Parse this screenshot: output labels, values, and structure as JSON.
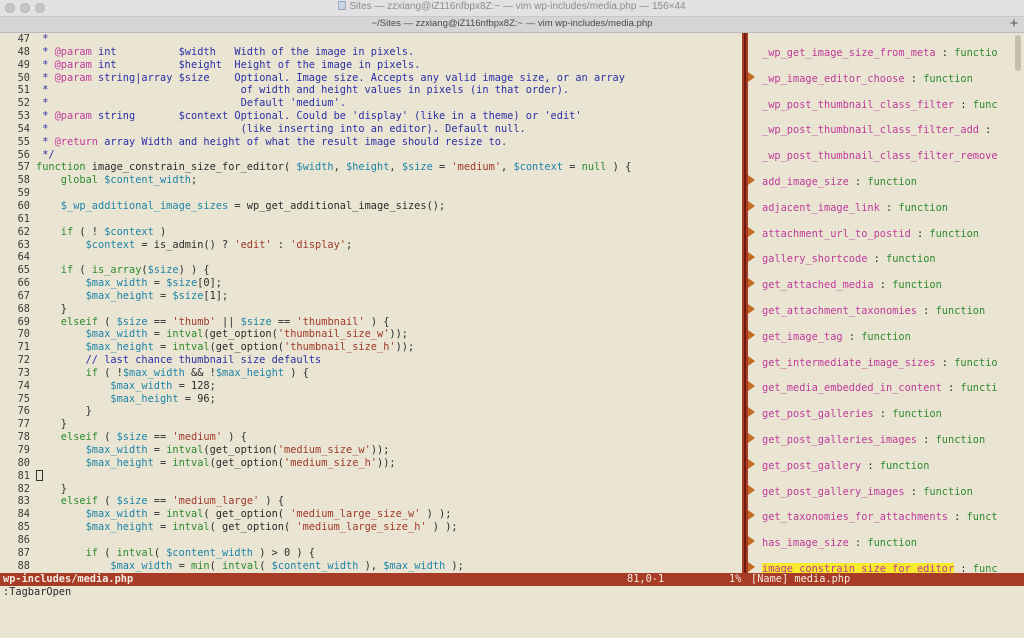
{
  "window": {
    "title": "Sites — zzxiang@iZ116nfbpx8Z:~ — vim wp-includes/media.php — 156×44",
    "tab_title": "~/Sites — zzxiang@iZ116nfbpx8Z:~ — vim wp-includes/media.php",
    "new_tab_label": "+"
  },
  "code_lines": [
    {
      "n": "47",
      "segs": [
        {
          "c": "cm",
          "t": " *"
        }
      ]
    },
    {
      "n": "48",
      "segs": [
        {
          "c": "cm",
          "t": " * "
        },
        {
          "c": "tag",
          "t": "@param"
        },
        {
          "c": "cm",
          "t": " int          $width   Width of the image in pixels."
        }
      ]
    },
    {
      "n": "49",
      "segs": [
        {
          "c": "cm",
          "t": " * "
        },
        {
          "c": "tag",
          "t": "@param"
        },
        {
          "c": "cm",
          "t": " int          $height  Height of the image in pixels."
        }
      ]
    },
    {
      "n": "50",
      "segs": [
        {
          "c": "cm",
          "t": " * "
        },
        {
          "c": "tag",
          "t": "@param"
        },
        {
          "c": "cm",
          "t": " string|array $size    Optional. Image size. Accepts any valid image size, or an array"
        }
      ]
    },
    {
      "n": "51",
      "segs": [
        {
          "c": "cm",
          "t": " *                               of width and height values in pixels (in that order)."
        }
      ]
    },
    {
      "n": "52",
      "segs": [
        {
          "c": "cm",
          "t": " *                               Default 'medium'."
        }
      ]
    },
    {
      "n": "53",
      "segs": [
        {
          "c": "cm",
          "t": " * "
        },
        {
          "c": "tag",
          "t": "@param"
        },
        {
          "c": "cm",
          "t": " string       $context Optional. Could be 'display' (like in a theme) or 'edit'"
        }
      ]
    },
    {
      "n": "54",
      "segs": [
        {
          "c": "cm",
          "t": " *                               (like inserting into an editor). Default null."
        }
      ]
    },
    {
      "n": "55",
      "segs": [
        {
          "c": "cm",
          "t": " * "
        },
        {
          "c": "tag",
          "t": "@return"
        },
        {
          "c": "cm",
          "t": " array Width and height of what the result image should resize to."
        }
      ]
    },
    {
      "n": "56",
      "segs": [
        {
          "c": "cm",
          "t": " */"
        }
      ]
    },
    {
      "n": "57",
      "segs": [
        {
          "c": "kw",
          "t": "function"
        },
        {
          "c": "plain",
          "t": " image_constrain_size_for_editor( "
        },
        {
          "c": "var",
          "t": "$width"
        },
        {
          "c": "plain",
          "t": ", "
        },
        {
          "c": "var",
          "t": "$height"
        },
        {
          "c": "plain",
          "t": ", "
        },
        {
          "c": "var",
          "t": "$size"
        },
        {
          "c": "plain",
          "t": " = "
        },
        {
          "c": "str",
          "t": "'medium'"
        },
        {
          "c": "plain",
          "t": ", "
        },
        {
          "c": "var",
          "t": "$context"
        },
        {
          "c": "plain",
          "t": " = "
        },
        {
          "c": "kw",
          "t": "null"
        },
        {
          "c": "plain",
          "t": " ) {"
        }
      ]
    },
    {
      "n": "58",
      "segs": [
        {
          "c": "kw",
          "t": "    global"
        },
        {
          "c": "plain",
          "t": " "
        },
        {
          "c": "var",
          "t": "$content_width"
        },
        {
          "c": "plain",
          "t": ";"
        }
      ]
    },
    {
      "n": "59",
      "segs": []
    },
    {
      "n": "60",
      "segs": [
        {
          "c": "var",
          "t": "    $_wp_additional_image_sizes"
        },
        {
          "c": "plain",
          "t": " = wp_get_additional_image_sizes();"
        }
      ]
    },
    {
      "n": "61",
      "segs": []
    },
    {
      "n": "62",
      "segs": [
        {
          "c": "kw",
          "t": "    if"
        },
        {
          "c": "plain",
          "t": " ( ! "
        },
        {
          "c": "var",
          "t": "$context"
        },
        {
          "c": "plain",
          "t": " )"
        }
      ]
    },
    {
      "n": "63",
      "segs": [
        {
          "c": "var",
          "t": "        $context"
        },
        {
          "c": "plain",
          "t": " = is_admin() ? "
        },
        {
          "c": "str",
          "t": "'edit'"
        },
        {
          "c": "plain",
          "t": " : "
        },
        {
          "c": "str",
          "t": "'display'"
        },
        {
          "c": "plain",
          "t": ";"
        }
      ]
    },
    {
      "n": "64",
      "segs": []
    },
    {
      "n": "65",
      "segs": [
        {
          "c": "kw",
          "t": "    if"
        },
        {
          "c": "plain",
          "t": " ( "
        },
        {
          "c": "fn",
          "t": "is_array"
        },
        {
          "c": "plain",
          "t": "("
        },
        {
          "c": "var",
          "t": "$size"
        },
        {
          "c": "plain",
          "t": ") ) {"
        }
      ]
    },
    {
      "n": "66",
      "segs": [
        {
          "c": "var",
          "t": "        $max_width"
        },
        {
          "c": "plain",
          "t": " = "
        },
        {
          "c": "var",
          "t": "$size"
        },
        {
          "c": "plain",
          "t": "[0];"
        }
      ]
    },
    {
      "n": "67",
      "segs": [
        {
          "c": "var",
          "t": "        $max_height"
        },
        {
          "c": "plain",
          "t": " = "
        },
        {
          "c": "var",
          "t": "$size"
        },
        {
          "c": "plain",
          "t": "[1];"
        }
      ]
    },
    {
      "n": "68",
      "segs": [
        {
          "c": "plain",
          "t": "    }"
        }
      ]
    },
    {
      "n": "69",
      "segs": [
        {
          "c": "kw",
          "t": "    elseif"
        },
        {
          "c": "plain",
          "t": " ( "
        },
        {
          "c": "var",
          "t": "$size"
        },
        {
          "c": "plain",
          "t": " == "
        },
        {
          "c": "str",
          "t": "'thumb'"
        },
        {
          "c": "plain",
          "t": " || "
        },
        {
          "c": "var",
          "t": "$size"
        },
        {
          "c": "plain",
          "t": " == "
        },
        {
          "c": "str",
          "t": "'thumbnail'"
        },
        {
          "c": "plain",
          "t": " ) {"
        }
      ]
    },
    {
      "n": "70",
      "segs": [
        {
          "c": "var",
          "t": "        $max_width"
        },
        {
          "c": "plain",
          "t": " = "
        },
        {
          "c": "fn",
          "t": "intval"
        },
        {
          "c": "plain",
          "t": "(get_option("
        },
        {
          "c": "str",
          "t": "'thumbnail_size_w'"
        },
        {
          "c": "plain",
          "t": "));"
        }
      ]
    },
    {
      "n": "71",
      "segs": [
        {
          "c": "var",
          "t": "        $max_height"
        },
        {
          "c": "plain",
          "t": " = "
        },
        {
          "c": "fn",
          "t": "intval"
        },
        {
          "c": "plain",
          "t": "(get_option("
        },
        {
          "c": "str",
          "t": "'thumbnail_size_h'"
        },
        {
          "c": "plain",
          "t": "));"
        }
      ]
    },
    {
      "n": "72",
      "segs": [
        {
          "c": "cm",
          "t": "        // last chance thumbnail size defaults"
        }
      ]
    },
    {
      "n": "73",
      "segs": [
        {
          "c": "kw",
          "t": "        if"
        },
        {
          "c": "plain",
          "t": " ( !"
        },
        {
          "c": "var",
          "t": "$max_width"
        },
        {
          "c": "plain",
          "t": " && !"
        },
        {
          "c": "var",
          "t": "$max_height"
        },
        {
          "c": "plain",
          "t": " ) {"
        }
      ]
    },
    {
      "n": "74",
      "segs": [
        {
          "c": "var",
          "t": "            $max_width"
        },
        {
          "c": "plain",
          "t": " = 128;"
        }
      ]
    },
    {
      "n": "75",
      "segs": [
        {
          "c": "var",
          "t": "            $max_height"
        },
        {
          "c": "plain",
          "t": " = 96;"
        }
      ]
    },
    {
      "n": "76",
      "segs": [
        {
          "c": "plain",
          "t": "        }"
        }
      ]
    },
    {
      "n": "77",
      "segs": [
        {
          "c": "plain",
          "t": "    }"
        }
      ]
    },
    {
      "n": "78",
      "segs": [
        {
          "c": "kw",
          "t": "    elseif"
        },
        {
          "c": "plain",
          "t": " ( "
        },
        {
          "c": "var",
          "t": "$size"
        },
        {
          "c": "plain",
          "t": " == "
        },
        {
          "c": "str",
          "t": "'medium'"
        },
        {
          "c": "plain",
          "t": " ) {"
        }
      ]
    },
    {
      "n": "79",
      "segs": [
        {
          "c": "var",
          "t": "        $max_width"
        },
        {
          "c": "plain",
          "t": " = "
        },
        {
          "c": "fn",
          "t": "intval"
        },
        {
          "c": "plain",
          "t": "(get_option("
        },
        {
          "c": "str",
          "t": "'medium_size_w'"
        },
        {
          "c": "plain",
          "t": "));"
        }
      ]
    },
    {
      "n": "80",
      "segs": [
        {
          "c": "var",
          "t": "        $max_height"
        },
        {
          "c": "plain",
          "t": " = "
        },
        {
          "c": "fn",
          "t": "intval"
        },
        {
          "c": "plain",
          "t": "(get_option("
        },
        {
          "c": "str",
          "t": "'medium_size_h'"
        },
        {
          "c": "plain",
          "t": "));"
        }
      ]
    },
    {
      "n": "81",
      "cursor": true,
      "segs": []
    },
    {
      "n": "82",
      "segs": [
        {
          "c": "plain",
          "t": "    }"
        }
      ]
    },
    {
      "n": "83",
      "segs": [
        {
          "c": "kw",
          "t": "    elseif"
        },
        {
          "c": "plain",
          "t": " ( "
        },
        {
          "c": "var",
          "t": "$size"
        },
        {
          "c": "plain",
          "t": " == "
        },
        {
          "c": "str",
          "t": "'medium_large'"
        },
        {
          "c": "plain",
          "t": " ) {"
        }
      ]
    },
    {
      "n": "84",
      "segs": [
        {
          "c": "var",
          "t": "        $max_width"
        },
        {
          "c": "plain",
          "t": " = "
        },
        {
          "c": "fn",
          "t": "intval"
        },
        {
          "c": "plain",
          "t": "( get_option( "
        },
        {
          "c": "str",
          "t": "'medium_large_size_w'"
        },
        {
          "c": "plain",
          "t": " ) );"
        }
      ]
    },
    {
      "n": "85",
      "segs": [
        {
          "c": "var",
          "t": "        $max_height"
        },
        {
          "c": "plain",
          "t": " = "
        },
        {
          "c": "fn",
          "t": "intval"
        },
        {
          "c": "plain",
          "t": "( get_option( "
        },
        {
          "c": "str",
          "t": "'medium_large_size_h'"
        },
        {
          "c": "plain",
          "t": " ) );"
        }
      ]
    },
    {
      "n": "86",
      "segs": []
    },
    {
      "n": "87",
      "segs": [
        {
          "c": "kw",
          "t": "        if"
        },
        {
          "c": "plain",
          "t": " ( "
        },
        {
          "c": "fn",
          "t": "intval"
        },
        {
          "c": "plain",
          "t": "( "
        },
        {
          "c": "var",
          "t": "$content_width"
        },
        {
          "c": "plain",
          "t": " ) > 0 ) {"
        }
      ]
    },
    {
      "n": "88",
      "segs": [
        {
          "c": "var",
          "t": "            $max_width"
        },
        {
          "c": "plain",
          "t": " = "
        },
        {
          "c": "fn",
          "t": "min"
        },
        {
          "c": "plain",
          "t": "( "
        },
        {
          "c": "fn",
          "t": "intval"
        },
        {
          "c": "plain",
          "t": "( "
        },
        {
          "c": "var",
          "t": "$content_width"
        },
        {
          "c": "plain",
          "t": " ), "
        },
        {
          "c": "var",
          "t": "$max_width"
        },
        {
          "c": "plain",
          "t": " );"
        }
      ]
    }
  ],
  "tagbar": {
    "items": [
      {
        "name": "_wp_get_image_size_from_meta",
        "sep": " : ",
        "kind": "functio",
        "arrow": false,
        "highlight": false
      },
      {
        "name": "_wp_image_editor_choose",
        "sep": " : ",
        "kind": "function",
        "arrow": true,
        "highlight": false
      },
      {
        "name": "_wp_post_thumbnail_class_filter",
        "sep": " : ",
        "kind": "func",
        "arrow": false,
        "highlight": false
      },
      {
        "name": "_wp_post_thumbnail_class_filter_add",
        "sep": " :",
        "kind": "",
        "arrow": false,
        "highlight": false
      },
      {
        "name": "_wp_post_thumbnail_class_filter_remove",
        "sep": "",
        "kind": "",
        "arrow": false,
        "highlight": false
      },
      {
        "name": "add_image_size",
        "sep": " : ",
        "kind": "function",
        "arrow": true,
        "highlight": false
      },
      {
        "name": "adjacent_image_link",
        "sep": " : ",
        "kind": "function",
        "arrow": true,
        "highlight": false
      },
      {
        "name": "attachment_url_to_postid",
        "sep": " : ",
        "kind": "function",
        "arrow": true,
        "highlight": false
      },
      {
        "name": "gallery_shortcode",
        "sep": " : ",
        "kind": "function",
        "arrow": true,
        "highlight": false
      },
      {
        "name": "get_attached_media",
        "sep": " : ",
        "kind": "function",
        "arrow": true,
        "highlight": false
      },
      {
        "name": "get_attachment_taxonomies",
        "sep": " : ",
        "kind": "function",
        "arrow": true,
        "highlight": false
      },
      {
        "name": "get_image_tag",
        "sep": " : ",
        "kind": "function",
        "arrow": true,
        "highlight": false
      },
      {
        "name": "get_intermediate_image_sizes",
        "sep": " : ",
        "kind": "functio",
        "arrow": true,
        "highlight": false
      },
      {
        "name": "get_media_embedded_in_content",
        "sep": " : ",
        "kind": "functi",
        "arrow": true,
        "highlight": false
      },
      {
        "name": "get_post_galleries",
        "sep": " : ",
        "kind": "function",
        "arrow": true,
        "highlight": false
      },
      {
        "name": "get_post_galleries_images",
        "sep": " : ",
        "kind": "function",
        "arrow": true,
        "highlight": false
      },
      {
        "name": "get_post_gallery",
        "sep": " : ",
        "kind": "function",
        "arrow": true,
        "highlight": false
      },
      {
        "name": "get_post_gallery_images",
        "sep": " : ",
        "kind": "function",
        "arrow": true,
        "highlight": false
      },
      {
        "name": "get_taxonomies_for_attachments",
        "sep": " : ",
        "kind": "funct",
        "arrow": true,
        "highlight": false
      },
      {
        "name": "has_image_size",
        "sep": " : ",
        "kind": "function",
        "arrow": true,
        "highlight": false
      },
      {
        "name": "image_constrain_size_for_editor",
        "sep": " : ",
        "kind": "func",
        "arrow": true,
        "highlight": true
      }
    ]
  },
  "statusline": {
    "filename": "wp-includes/media.php",
    "position": "81,0-1",
    "percent": "1%",
    "right": "[Name] media.php"
  },
  "cmdline": {
    "text": ":TagbarOpen"
  },
  "colors": {
    "background": "#eae5d3",
    "statusbar": "#a83b26",
    "comment": "#2b2fa6",
    "keyword": "#2e8a2e",
    "variable": "#1e84a8",
    "string": "#a13a2a",
    "tag_name": "#c03a9a",
    "highlight": "#f5ea2c"
  }
}
